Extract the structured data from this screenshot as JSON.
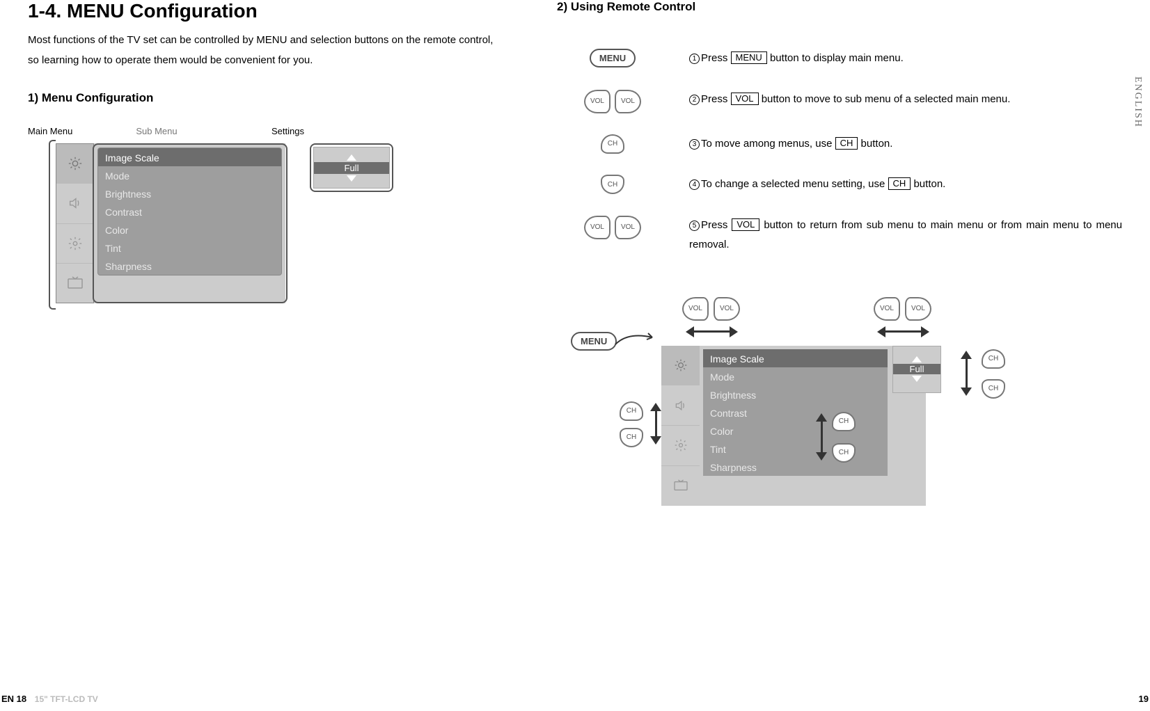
{
  "page_title": "1-4. MENU Configuration",
  "intro": "Most functions of the TV set can be controlled by MENU and selection buttons on the remote control, so learning how to operate them would be convenient for you.",
  "section1_title": "1) Menu Configuration",
  "section2_title": "2) Using Remote Control",
  "labels": {
    "main_menu": "Main Menu",
    "sub_menu": "Sub Menu",
    "settings": "Settings"
  },
  "sub_items": [
    "Image Scale",
    "Mode",
    "Brightness",
    "Contrast",
    "Color",
    "Tint",
    "Sharpness"
  ],
  "settings_value": "Full",
  "buttons": {
    "menu": "MENU",
    "vol": "VOL",
    "ch": "CH"
  },
  "instructions": {
    "i1_a": "Press ",
    "i1_b": " button to display main menu.",
    "i2_a": "Press ",
    "i2_b": " button to move to sub menu of a selected main menu.",
    "i3_a": "To move among menus, use ",
    "i3_b": " button.",
    "i4_a": "To change a selected menu setting, use ",
    "i4_b": " button.",
    "i5_a": "Press ",
    "i5_b": " button to return from sub menu to main menu or from main menu to menu removal."
  },
  "side_tab": "ENGLISH",
  "footer": {
    "page_left": "EN 18",
    "product": "15\" TFT-LCD TV",
    "page_right": "19"
  }
}
